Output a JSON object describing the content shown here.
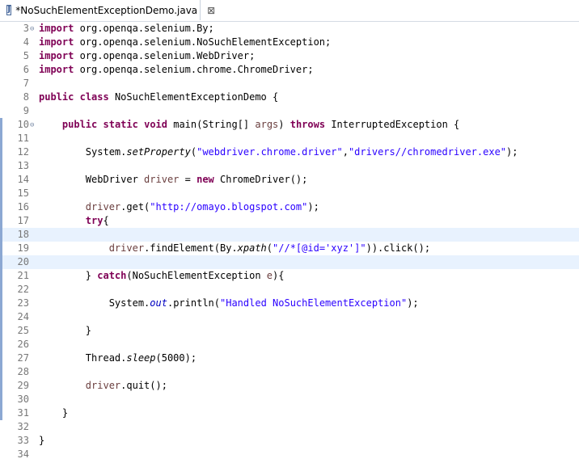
{
  "tab": {
    "title": "*NoSuchElementExceptionDemo.java",
    "close_glyph": "⊠",
    "icon": "java-file-icon",
    "icon_glyph": "J"
  },
  "colors": {
    "keyword": "#7f0055",
    "string": "#2a00ff",
    "local_variable": "#6a3e3e",
    "static_field": "#0000c0",
    "current_line_highlight": "#e8f2fe",
    "line_number": "#787878"
  },
  "lines": [
    {
      "n": "3",
      "fold": "⊖",
      "ruler": false,
      "hl": false,
      "tokens": [
        {
          "t": "import",
          "c": "kw"
        },
        {
          "t": " org.openqa.selenium.By;"
        }
      ]
    },
    {
      "n": "4",
      "ruler": false,
      "hl": false,
      "tokens": [
        {
          "t": "import",
          "c": "kw"
        },
        {
          "t": " org.openqa.selenium.NoSuchElementException;"
        }
      ]
    },
    {
      "n": "5",
      "ruler": false,
      "hl": false,
      "tokens": [
        {
          "t": "import",
          "c": "kw"
        },
        {
          "t": " org.openqa.selenium.WebDriver;"
        }
      ]
    },
    {
      "n": "6",
      "ruler": false,
      "hl": false,
      "tokens": [
        {
          "t": "import",
          "c": "kw"
        },
        {
          "t": " org.openqa.selenium.chrome.ChromeDriver;"
        }
      ]
    },
    {
      "n": "7",
      "ruler": false,
      "hl": false,
      "tokens": []
    },
    {
      "n": "8",
      "ruler": false,
      "hl": false,
      "tokens": [
        {
          "t": "public",
          "c": "kw"
        },
        {
          "t": " "
        },
        {
          "t": "class",
          "c": "kw"
        },
        {
          "t": " NoSuchElementExceptionDemo {"
        }
      ]
    },
    {
      "n": "9",
      "ruler": false,
      "hl": false,
      "tokens": []
    },
    {
      "n": "10",
      "fold": "⊖",
      "ruler": true,
      "hl": false,
      "tokens": [
        {
          "t": "    "
        },
        {
          "t": "public",
          "c": "kw"
        },
        {
          "t": " "
        },
        {
          "t": "static",
          "c": "kw"
        },
        {
          "t": " "
        },
        {
          "t": "void",
          "c": "kw"
        },
        {
          "t": " main(String[] "
        },
        {
          "t": "args",
          "c": "var"
        },
        {
          "t": ") "
        },
        {
          "t": "throws",
          "c": "kw"
        },
        {
          "t": " InterruptedException {"
        }
      ]
    },
    {
      "n": "11",
      "ruler": true,
      "hl": false,
      "tokens": []
    },
    {
      "n": "12",
      "ruler": true,
      "hl": false,
      "tokens": [
        {
          "t": "        System."
        },
        {
          "t": "setProperty",
          "c": "ital"
        },
        {
          "t": "("
        },
        {
          "t": "\"webdriver.chrome.driver\"",
          "c": "str"
        },
        {
          "t": ","
        },
        {
          "t": "\"drivers//chromedriver.exe\"",
          "c": "str"
        },
        {
          "t": ");"
        }
      ]
    },
    {
      "n": "13",
      "ruler": true,
      "hl": false,
      "tokens": []
    },
    {
      "n": "14",
      "ruler": true,
      "hl": false,
      "tokens": [
        {
          "t": "        WebDriver "
        },
        {
          "t": "driver",
          "c": "var"
        },
        {
          "t": " = "
        },
        {
          "t": "new",
          "c": "kw"
        },
        {
          "t": " ChromeDriver();"
        }
      ]
    },
    {
      "n": "15",
      "ruler": true,
      "hl": false,
      "tokens": []
    },
    {
      "n": "16",
      "ruler": true,
      "hl": false,
      "tokens": [
        {
          "t": "        "
        },
        {
          "t": "driver",
          "c": "var"
        },
        {
          "t": ".get("
        },
        {
          "t": "\"http://omayo.blogspot.com\"",
          "c": "str"
        },
        {
          "t": ");"
        }
      ]
    },
    {
      "n": "17",
      "ruler": true,
      "hl": false,
      "tokens": [
        {
          "t": "        "
        },
        {
          "t": "try",
          "c": "kw"
        },
        {
          "t": "{"
        }
      ]
    },
    {
      "n": "18",
      "ruler": true,
      "hl": true,
      "tokens": []
    },
    {
      "n": "19",
      "ruler": true,
      "hl": false,
      "tokens": [
        {
          "t": "            "
        },
        {
          "t": "driver",
          "c": "var"
        },
        {
          "t": ".findElement(By."
        },
        {
          "t": "xpath",
          "c": "ital"
        },
        {
          "t": "("
        },
        {
          "t": "\"//*[@id='xyz']\"",
          "c": "str"
        },
        {
          "t": ")).click();"
        }
      ]
    },
    {
      "n": "20",
      "ruler": true,
      "hl": true,
      "tokens": []
    },
    {
      "n": "21",
      "ruler": true,
      "hl": false,
      "tokens": [
        {
          "t": "        } "
        },
        {
          "t": "catch",
          "c": "kw"
        },
        {
          "t": "(NoSuchElementException "
        },
        {
          "t": "e",
          "c": "var"
        },
        {
          "t": "){"
        }
      ]
    },
    {
      "n": "22",
      "ruler": true,
      "hl": false,
      "tokens": []
    },
    {
      "n": "23",
      "ruler": true,
      "hl": false,
      "tokens": [
        {
          "t": "            System."
        },
        {
          "t": "out",
          "c": "fld"
        },
        {
          "t": ".println("
        },
        {
          "t": "\"Handled NoSuchElementException\"",
          "c": "str"
        },
        {
          "t": ");"
        }
      ]
    },
    {
      "n": "24",
      "ruler": true,
      "hl": false,
      "tokens": []
    },
    {
      "n": "25",
      "ruler": true,
      "hl": false,
      "tokens": [
        {
          "t": "        }"
        }
      ]
    },
    {
      "n": "26",
      "ruler": true,
      "hl": false,
      "tokens": []
    },
    {
      "n": "27",
      "ruler": true,
      "hl": false,
      "tokens": [
        {
          "t": "        Thread."
        },
        {
          "t": "sleep",
          "c": "ital"
        },
        {
          "t": "(5000);"
        }
      ]
    },
    {
      "n": "28",
      "ruler": true,
      "hl": false,
      "tokens": []
    },
    {
      "n": "29",
      "ruler": true,
      "hl": false,
      "tokens": [
        {
          "t": "        "
        },
        {
          "t": "driver",
          "c": "var"
        },
        {
          "t": ".quit();"
        }
      ]
    },
    {
      "n": "30",
      "ruler": true,
      "hl": false,
      "tokens": []
    },
    {
      "n": "31",
      "ruler": true,
      "hl": false,
      "tokens": [
        {
          "t": "    }"
        }
      ]
    },
    {
      "n": "32",
      "ruler": false,
      "hl": false,
      "tokens": []
    },
    {
      "n": "33",
      "ruler": false,
      "hl": false,
      "tokens": [
        {
          "t": "}"
        }
      ]
    },
    {
      "n": "34",
      "ruler": false,
      "hl": false,
      "tokens": []
    }
  ]
}
